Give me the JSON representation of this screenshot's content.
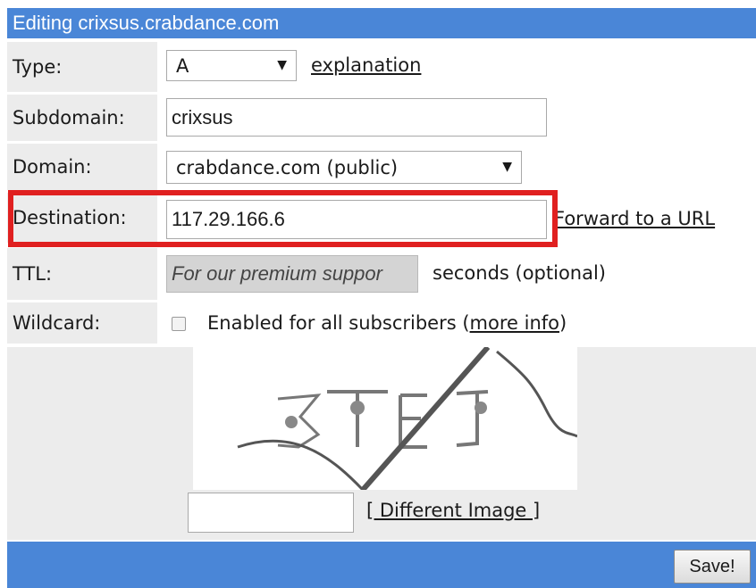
{
  "header": {
    "title": "Editing crixsus.crabdance.com"
  },
  "form": {
    "type": {
      "label": "Type:",
      "value": "A",
      "link": "explanation"
    },
    "subdomain": {
      "label": "Subdomain:",
      "value": "crixsus"
    },
    "domain": {
      "label": "Domain:",
      "value": "crabdance.com (public)"
    },
    "destination": {
      "label": "Destination:",
      "value": "117.29.166.6",
      "link": "Forward to a URL"
    },
    "ttl": {
      "label": "TTL:",
      "placeholder": "For our premium suppor",
      "suffix": "seconds (optional)"
    },
    "wildcard": {
      "label": "Wildcard:",
      "checked": false,
      "text_before": "Enabled for all subscribers (",
      "link": "more info",
      "text_after": ")"
    }
  },
  "captcha": {
    "link": "[ Different Image ]",
    "input_value": ""
  },
  "footer": {
    "save_label": "Save!"
  },
  "colors": {
    "header_bg": "#4a86d7",
    "label_bg": "#ececec",
    "highlight": "#e02020"
  }
}
